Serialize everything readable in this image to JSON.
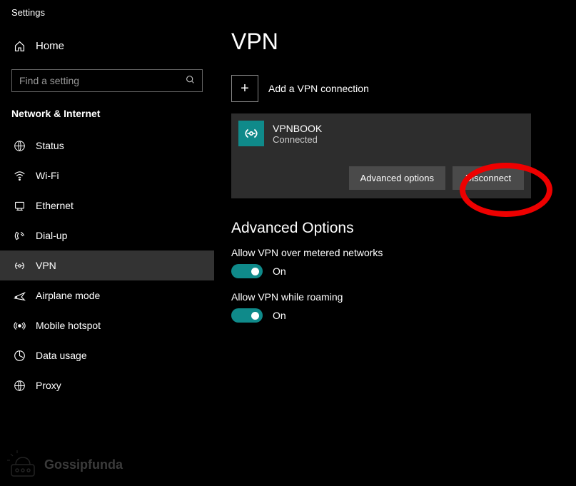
{
  "app_title": "Settings",
  "home_label": "Home",
  "search_placeholder": "Find a setting",
  "category_label": "Network & Internet",
  "nav": [
    {
      "label": "Status",
      "icon": "status-icon"
    },
    {
      "label": "Wi-Fi",
      "icon": "wifi-icon"
    },
    {
      "label": "Ethernet",
      "icon": "ethernet-icon"
    },
    {
      "label": "Dial-up",
      "icon": "dialup-icon"
    },
    {
      "label": "VPN",
      "icon": "vpn-icon",
      "active": true
    },
    {
      "label": "Airplane mode",
      "icon": "airplane-icon"
    },
    {
      "label": "Mobile hotspot",
      "icon": "hotspot-icon"
    },
    {
      "label": "Data usage",
      "icon": "datausage-icon"
    },
    {
      "label": "Proxy",
      "icon": "proxy-icon"
    }
  ],
  "main": {
    "title": "VPN",
    "add_label": "Add a VPN connection",
    "connection": {
      "name": "VPNBOOK",
      "status": "Connected",
      "advanced_btn": "Advanced options",
      "disconnect_btn": "Disconnect"
    },
    "adv_section_title": "Advanced Options",
    "toggles": [
      {
        "label": "Allow VPN over metered networks",
        "state": "On"
      },
      {
        "label": "Allow VPN while roaming",
        "state": "On"
      }
    ]
  },
  "footer_watermark": "Gossipfunda"
}
